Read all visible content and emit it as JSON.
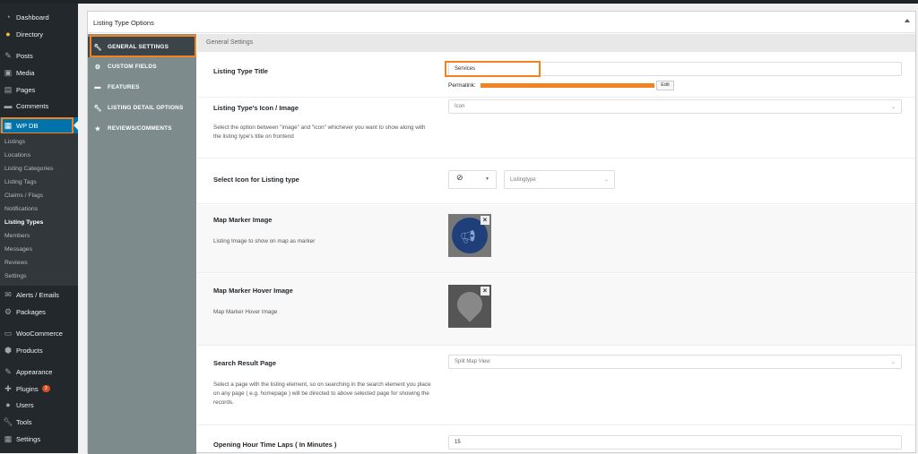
{
  "sidebar": {
    "top_items": [
      {
        "label": "Dashboard",
        "icon": "dashboard-icon"
      },
      {
        "label": "Directory",
        "icon": "directory-icon"
      },
      {
        "label": "Posts",
        "icon": "pin-icon"
      },
      {
        "label": "Media",
        "icon": "media-icon"
      },
      {
        "label": "Pages",
        "icon": "page-icon"
      },
      {
        "label": "Comments",
        "icon": "comment-icon"
      }
    ],
    "active": {
      "label": "WP DB",
      "icon": "database-icon"
    },
    "submenu": [
      "Listings",
      "Locations",
      "Listing Categories",
      "Listing Tags",
      "Claims / Flags",
      "Notifications",
      "Listing Types",
      "Members",
      "Messages",
      "Reviews",
      "Settings"
    ],
    "current_sub": "Listing Types",
    "bottom_items": [
      {
        "label": "Alerts / Emails",
        "icon": "mail-icon"
      },
      {
        "label": "Packages",
        "icon": "package-icon"
      },
      {
        "label": "WooCommerce",
        "icon": "woo-icon"
      },
      {
        "label": "Products",
        "icon": "product-icon"
      },
      {
        "label": "Appearance",
        "icon": "brush-icon"
      },
      {
        "label": "Plugins",
        "icon": "plugin-icon",
        "badge": "3"
      },
      {
        "label": "Users",
        "icon": "user-icon"
      },
      {
        "label": "Tools",
        "icon": "wrench-icon"
      },
      {
        "label": "Settings",
        "icon": "settings-icon"
      }
    ]
  },
  "panel": {
    "title": "Listing Type Options",
    "tabs": [
      {
        "label": "GENERAL SETTINGS",
        "icon": "wrench-icon"
      },
      {
        "label": "CUSTOM FIELDS",
        "icon": "gear-icon"
      },
      {
        "label": "FEATURES",
        "icon": "card-icon"
      },
      {
        "label": "LISTING DETAIL OPTIONS",
        "icon": "wrench-icon"
      },
      {
        "label": "REVIEWS/COMMENTS",
        "icon": "star-icon"
      }
    ],
    "section_title": "General Settings",
    "fields": {
      "title": {
        "label": "Listing Type Title",
        "value": "Services",
        "permalink_label": "Permalink:",
        "edit_label": "Edit"
      },
      "icon_image": {
        "label": "Listing Type's Icon / Image",
        "value": "Icon",
        "desc": "Select the option between \"image\" and \"icon\" whichever you want to show along with the listing type's title on frontend"
      },
      "select_icon": {
        "label": "Select Icon for Listing type",
        "search_placeholder": "Listingtype"
      },
      "marker": {
        "label": "Map Marker Image",
        "desc": "Listing Image to show on map as marker"
      },
      "marker_hover": {
        "label": "Map Marker Hover Image",
        "desc": "Map Marker Hover Image"
      },
      "search_page": {
        "label": "Search Result Page",
        "value": "Split Map View",
        "desc": "Select a page with the listing element, so on searching in the search element you place on any page ( e.g. homepage ) will be directed to above selected page for showing the records."
      },
      "opening_hours": {
        "label": "Opening Hour Time Laps ( In Minutes )",
        "value": "15"
      }
    }
  },
  "colors": {
    "highlight": "#f58220",
    "sidebar": "#23282d",
    "active": "#0073aa",
    "tabs": "#7d8b8c"
  }
}
